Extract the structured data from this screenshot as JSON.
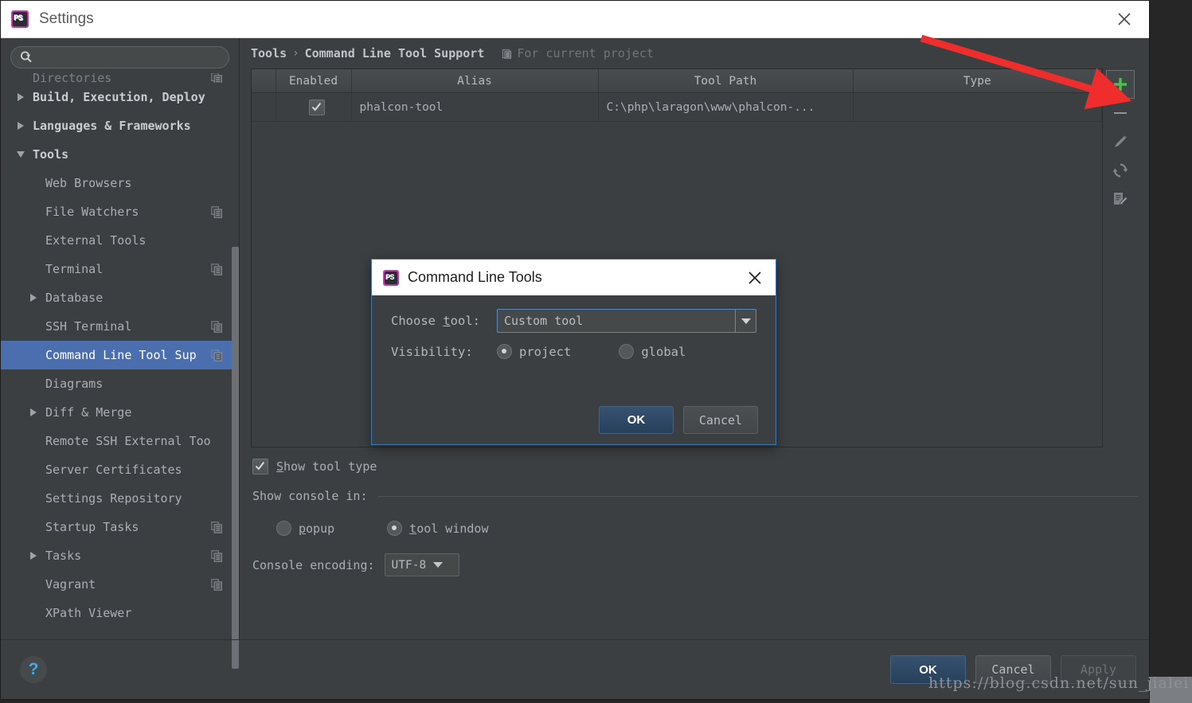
{
  "window": {
    "title": "Settings",
    "logo_text": "PS",
    "close_icon": "close-icon"
  },
  "search": {
    "value": "",
    "placeholder": "",
    "icon": "search-icon"
  },
  "sidebar": {
    "items": [
      {
        "label": "Directories",
        "level": 1,
        "arrow": "none",
        "bold": false,
        "clipped": true,
        "badge": true
      },
      {
        "label": "Build, Execution, Deploy",
        "level": 1,
        "arrow": "right",
        "bold": true,
        "clipped": false,
        "badge": false
      },
      {
        "label": "Languages & Frameworks",
        "level": 1,
        "arrow": "right",
        "bold": true,
        "clipped": false,
        "badge": false
      },
      {
        "label": "Tools",
        "level": 1,
        "arrow": "down",
        "bold": true,
        "clipped": false,
        "badge": false
      },
      {
        "label": "Web Browsers",
        "level": 2,
        "arrow": "none",
        "bold": false,
        "clipped": false,
        "badge": false
      },
      {
        "label": "File Watchers",
        "level": 2,
        "arrow": "none",
        "bold": false,
        "clipped": false,
        "badge": true
      },
      {
        "label": "External Tools",
        "level": 2,
        "arrow": "none",
        "bold": false,
        "clipped": false,
        "badge": false
      },
      {
        "label": "Terminal",
        "level": 2,
        "arrow": "none",
        "bold": false,
        "clipped": false,
        "badge": true
      },
      {
        "label": "Database",
        "level": 2,
        "arrow": "right",
        "bold": false,
        "clipped": false,
        "badge": false
      },
      {
        "label": "SSH Terminal",
        "level": 2,
        "arrow": "none",
        "bold": false,
        "clipped": false,
        "badge": true
      },
      {
        "label": "Command Line Tool Sup",
        "level": 2,
        "arrow": "none",
        "bold": false,
        "clipped": false,
        "badge": true,
        "selected": true
      },
      {
        "label": "Diagrams",
        "level": 2,
        "arrow": "none",
        "bold": false,
        "clipped": false,
        "badge": false
      },
      {
        "label": "Diff & Merge",
        "level": 2,
        "arrow": "right",
        "bold": false,
        "clipped": false,
        "badge": false
      },
      {
        "label": "Remote SSH External Too",
        "level": 2,
        "arrow": "none",
        "bold": false,
        "clipped": false,
        "badge": false
      },
      {
        "label": "Server Certificates",
        "level": 2,
        "arrow": "none",
        "bold": false,
        "clipped": false,
        "badge": false
      },
      {
        "label": "Settings Repository",
        "level": 2,
        "arrow": "none",
        "bold": false,
        "clipped": false,
        "badge": false
      },
      {
        "label": "Startup Tasks",
        "level": 2,
        "arrow": "none",
        "bold": false,
        "clipped": false,
        "badge": true
      },
      {
        "label": "Tasks",
        "level": 2,
        "arrow": "right",
        "bold": false,
        "clipped": false,
        "badge": true
      },
      {
        "label": "Vagrant",
        "level": 2,
        "arrow": "none",
        "bold": false,
        "clipped": false,
        "badge": true
      },
      {
        "label": "XPath Viewer",
        "level": 2,
        "arrow": "none",
        "bold": false,
        "clipped": false,
        "badge": false
      }
    ]
  },
  "breadcrumb": {
    "root": "Tools",
    "separator": "›",
    "leaf": "Command Line Tool Support",
    "scope_note": "For current project",
    "scope_icon": "project-scope-icon"
  },
  "table": {
    "headers": [
      "",
      "Enabled",
      "Alias",
      "Tool Path",
      "Type"
    ],
    "rows": [
      {
        "enabled": true,
        "alias": "phalcon-tool",
        "tool_path": "C:\\php\\laragon\\www\\phalcon-...",
        "type": ""
      }
    ]
  },
  "toolbar": {
    "buttons": [
      {
        "name": "add-tool-button",
        "icon": "plus-icon",
        "label": "+"
      },
      {
        "name": "remove-tool-button",
        "icon": "minus-icon",
        "label": "–"
      },
      {
        "name": "edit-tool-button",
        "icon": "pencil-icon",
        "label": ""
      },
      {
        "name": "reload-tool-button",
        "icon": "refresh-icon",
        "label": ""
      },
      {
        "name": "edit-document-button",
        "icon": "edit-document-icon",
        "label": ""
      }
    ]
  },
  "options": {
    "show_tool_type": {
      "label_underline": "S",
      "label_rest": "how tool type",
      "checked": true
    },
    "show_console_in": {
      "label": "Show console in:"
    },
    "console_radios": [
      {
        "label_underline": "p",
        "label_rest": "opup",
        "value": "popup",
        "selected": false
      },
      {
        "label_underline": "t",
        "label_rest": "ool window",
        "value": "tool window",
        "selected": true
      }
    ],
    "console_encoding": {
      "label": "Console encoding:",
      "value": "UTF-8"
    }
  },
  "footer": {
    "help_icon": "?",
    "ok": "OK",
    "cancel": "Cancel",
    "apply": "Apply"
  },
  "modal": {
    "title": "Command Line Tools",
    "logo_text": "PS",
    "close_icon": "close-icon",
    "choose_tool": {
      "label_pre": "Choose ",
      "label_underline": "t",
      "label_post": "ool:",
      "value": "Custom tool"
    },
    "visibility": {
      "label": "Visibility:",
      "options": [
        {
          "label": "project",
          "selected": true
        },
        {
          "label": "global",
          "selected": false
        }
      ]
    },
    "ok": "OK",
    "cancel": "Cancel"
  },
  "annotation": {
    "arrow_color": "#ef2d2d",
    "watermark": "https://blog.csdn.net/sun_jialei"
  },
  "colors": {
    "accent_selection": "#4b6eaf",
    "panel_bg": "#3c3f41",
    "primary_button": "#36526f",
    "plus_green": "#4fc04f"
  }
}
